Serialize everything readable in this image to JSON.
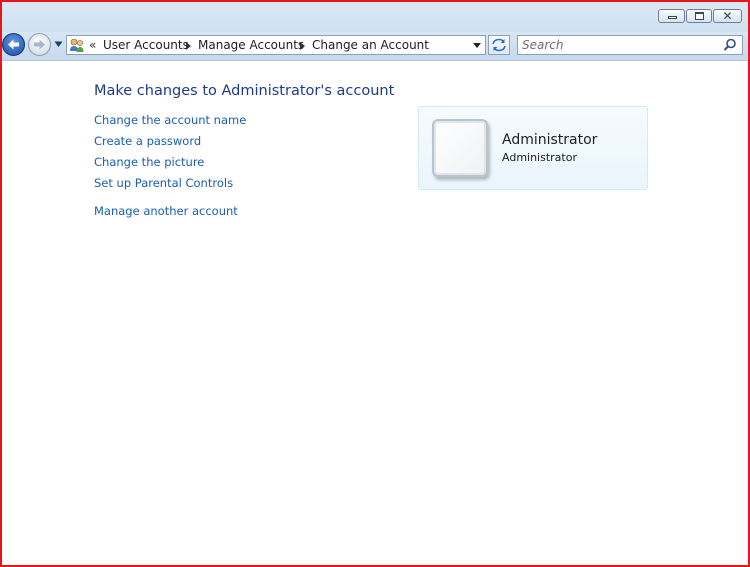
{
  "window": {
    "caption_buttons": [
      "minimize",
      "maximize",
      "close"
    ],
    "close_glyph": "✕"
  },
  "navigation": {
    "back_icon": "back-arrow-icon",
    "forward_icon": "forward-arrow-icon",
    "overflow_chevron": "«",
    "breadcrumbs": [
      "User Accounts",
      "Manage Accounts",
      "Change an Account"
    ],
    "search_placeholder": "Search"
  },
  "main": {
    "title": "Make changes to Administrator's account",
    "tasks": [
      "Change the account name",
      "Create a password",
      "Change the picture",
      "Set up Parental Controls"
    ],
    "other_link": "Manage another account"
  },
  "account": {
    "name": "Administrator",
    "type": "Administrator"
  },
  "colors": {
    "frame_border": "#e8151b",
    "link": "#1a5eb3",
    "title": "#1e3b8a"
  }
}
